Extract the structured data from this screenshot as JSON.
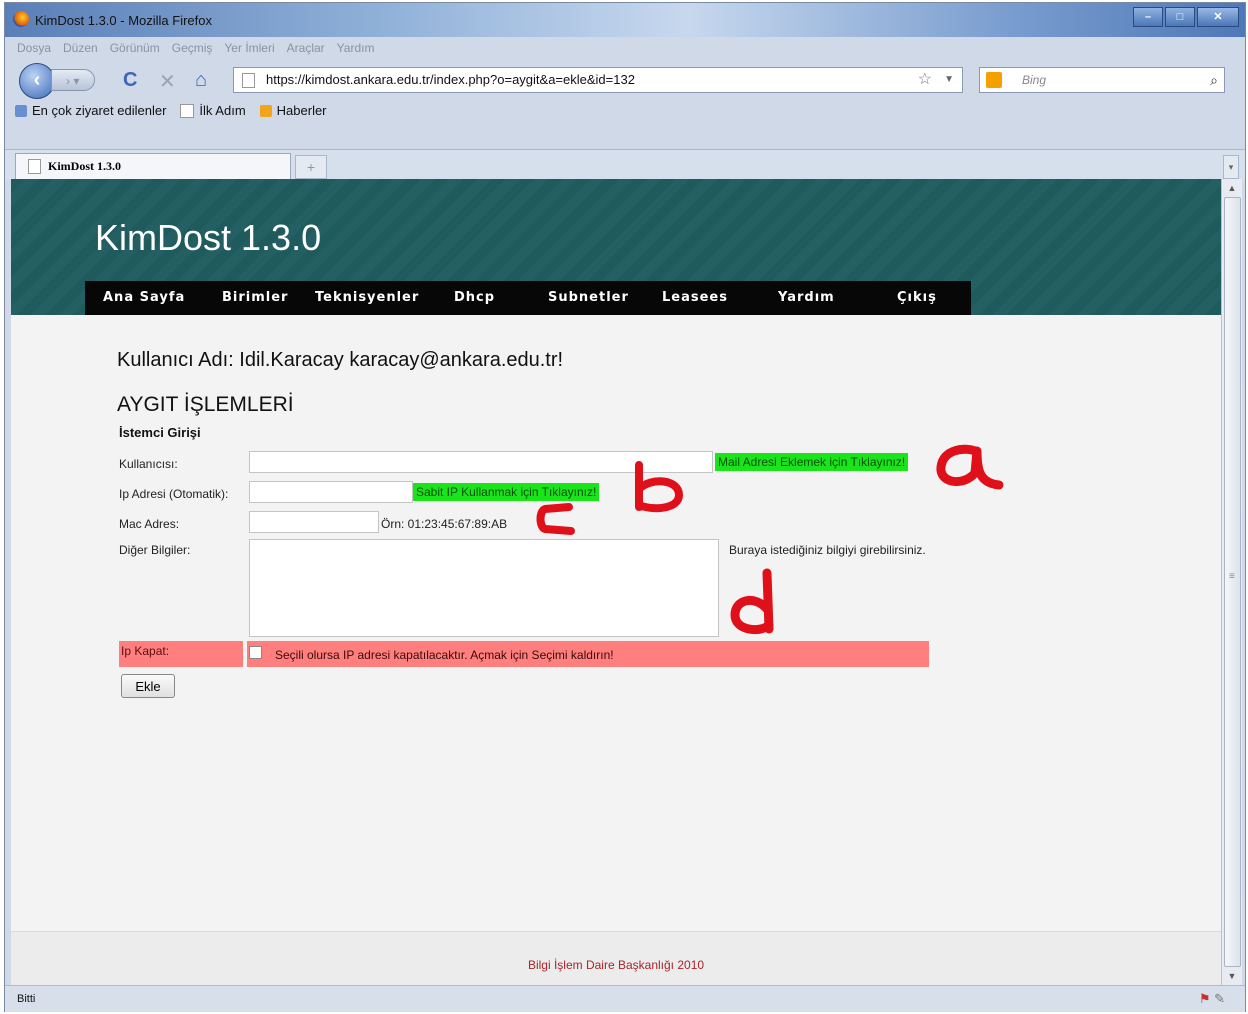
{
  "browser": {
    "window_title": "KimDost 1.3.0 - Mozilla Firefox",
    "menu": [
      "Dosya",
      "Düzen",
      "Görünüm",
      "Geçmiş",
      "Yer İmleri",
      "Araçlar",
      "Yardım"
    ],
    "url": "https://kimdost.ankara.edu.tr/index.php?o=aygit&a=ekle&id=132",
    "search_placeholder": "Bing",
    "bookmarks": [
      "En çok ziyaret edilenler",
      "İlk Adım",
      "Haberler"
    ],
    "tab_title": "KimDost 1.3.0",
    "new_tab": "+",
    "status": "Bitti"
  },
  "site": {
    "title": "KimDost 1.3.0",
    "nav": [
      "Ana Sayfa",
      "Birimler",
      "Teknisyenler",
      "Dhcp",
      "Subnetler",
      "Leasees",
      "Yardım",
      "Çıkış"
    ]
  },
  "page": {
    "user_line": "Kullanıcı Adı: Idil.Karacay karacay@ankara.edu.tr!",
    "section_title": "AYGIT İŞLEMLERİ",
    "form_heading": "İstemci Girişi",
    "fields": {
      "kullanici_label": "Kullanıcısı:",
      "kullanici_value": "",
      "mail_link": "Mail Adresi Eklemek için Tıklayınız!",
      "ip_label": "Ip Adresi (Otomatik):",
      "ip_value": "",
      "sabit_ip_link": "Sabit IP Kullanmak için Tıklayınız!",
      "mac_label": "Mac Adres:",
      "mac_value": "",
      "mac_example": "Örn: 01:23:45:67:89:AB",
      "diger_label": "Diğer Bilgiler:",
      "diger_value": "",
      "diger_hint": "Buraya istediğiniz bilgiyi girebilirsiniz.",
      "ip_kapat_label": "Ip Kapat:",
      "ip_kapat_text": "Seçili olursa IP adresi kapatılacaktır. Açmak için Seçimi kaldırın!"
    },
    "submit_label": "Ekle",
    "footer": "Bilgi İşlem Daire Başkanlığı 2010"
  },
  "annotations": [
    "a",
    "b",
    "c",
    "d"
  ],
  "colors": {
    "banner": "#1f5a5d",
    "green_link": "#19e51a",
    "pink_row": "#ff7f7f",
    "annotation": "#e0101a",
    "footer_text": "#a8252a"
  }
}
